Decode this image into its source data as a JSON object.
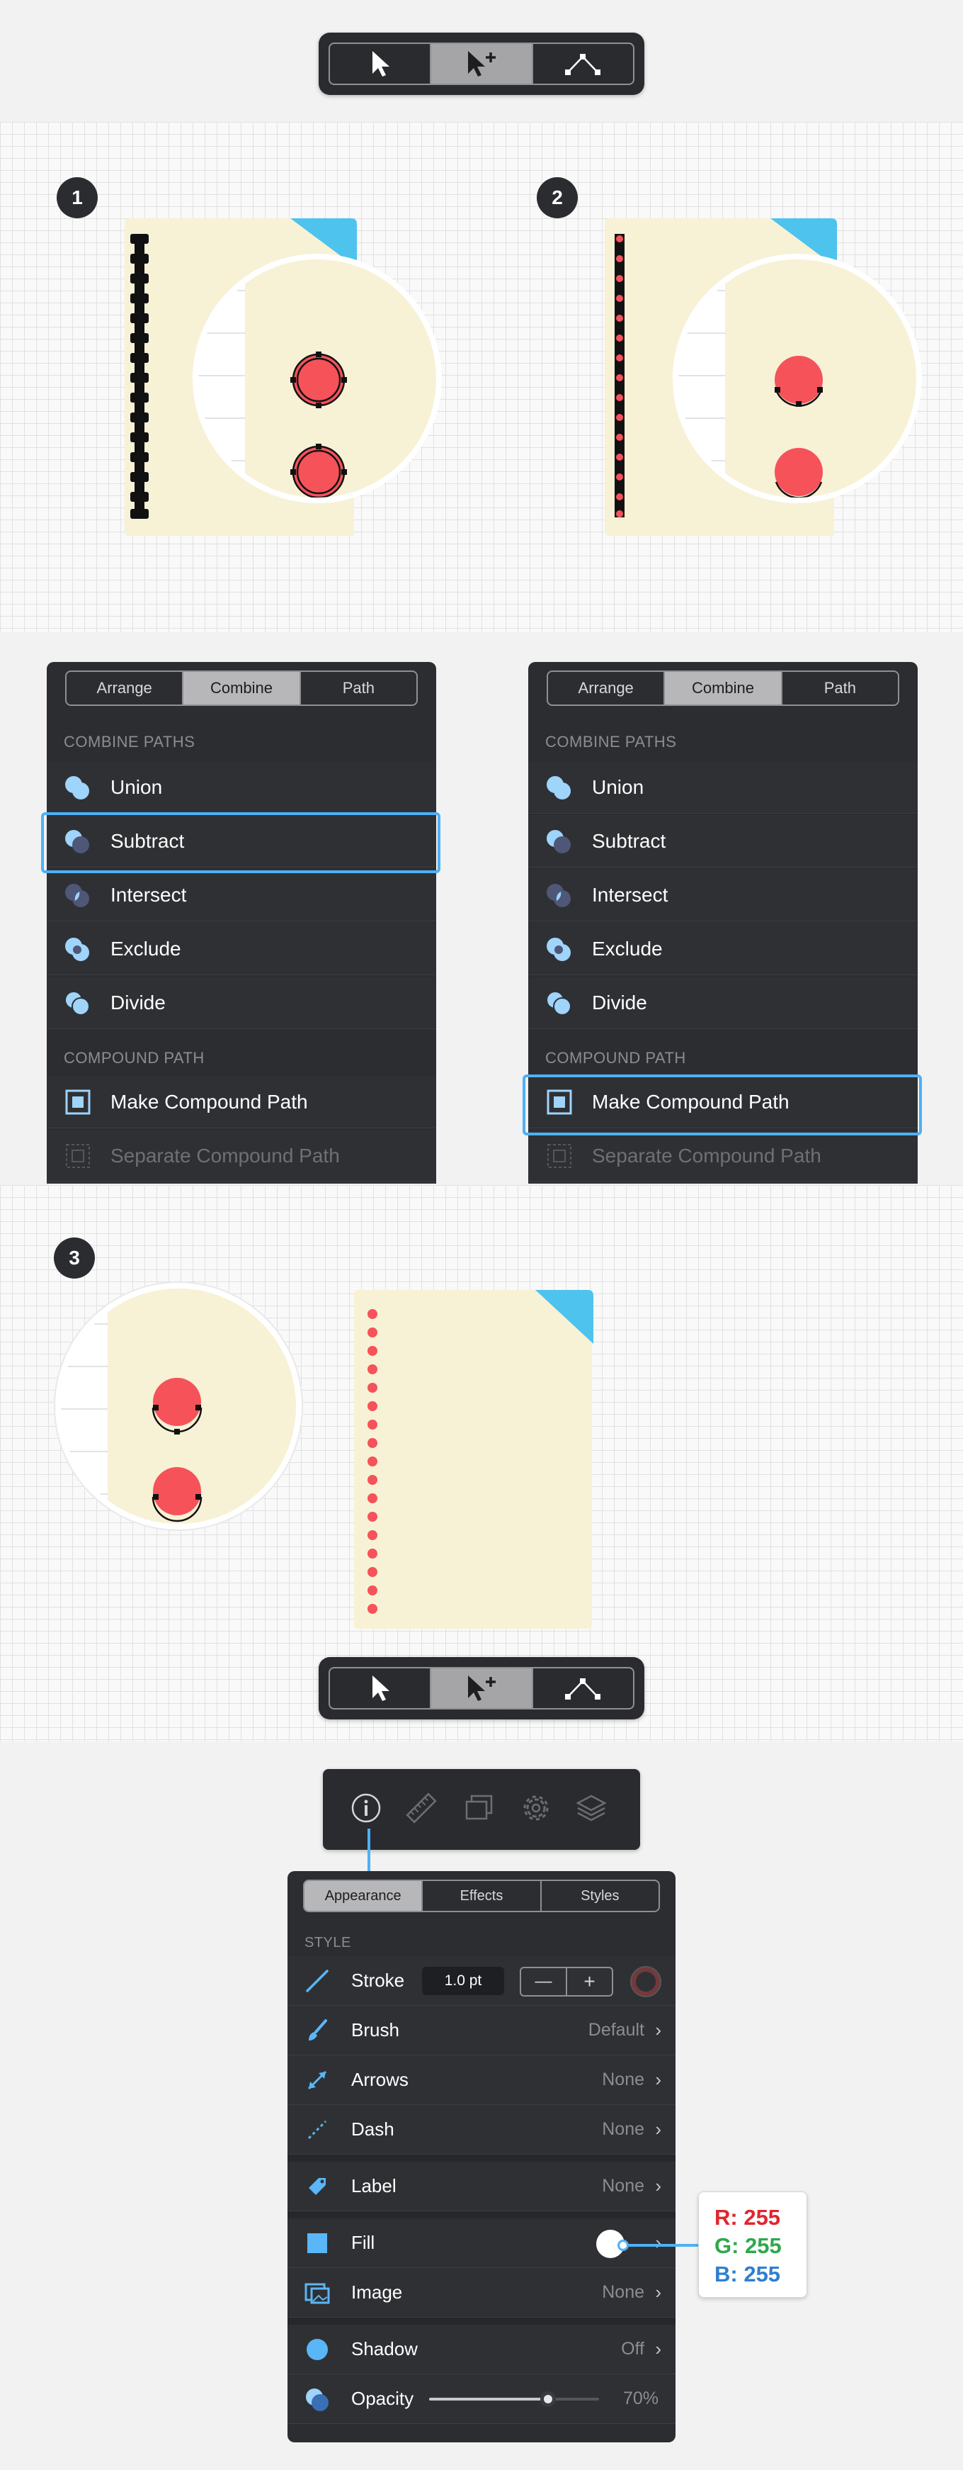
{
  "toolbar": {
    "tools": [
      {
        "name": "select-arrow-icon",
        "active": false
      },
      {
        "name": "direct-select-add-icon",
        "active": true
      },
      {
        "name": "node-path-icon",
        "active": false
      }
    ]
  },
  "steps": {
    "one": "1",
    "two": "2",
    "three": "3"
  },
  "combine_panel": {
    "tabs": [
      "Arrange",
      "Combine",
      "Path"
    ],
    "active_tab": "Combine",
    "section_combine": "COMBINE PATHS",
    "items": [
      "Union",
      "Subtract",
      "Intersect",
      "Exclude",
      "Divide"
    ],
    "section_compound": "COMPOUND PATH",
    "compound_items": [
      "Make Compound Path",
      "Separate Compound Path"
    ],
    "left_highlight": "Subtract",
    "right_highlight": "Make Compound Path"
  },
  "inspector": {
    "tabs": [
      "Appearance",
      "Effects",
      "Styles"
    ],
    "active_tab": "Appearance",
    "section_style": "STYLE",
    "stroke": {
      "label": "Stroke",
      "value": "1.0 pt",
      "minus": "—",
      "plus": "+"
    },
    "rows": [
      {
        "label": "Brush",
        "value": "Default"
      },
      {
        "label": "Arrows",
        "value": "None"
      },
      {
        "label": "Dash",
        "value": "None"
      },
      {
        "label": "Label",
        "value": "None"
      },
      {
        "label": "Fill",
        "value": ""
      },
      {
        "label": "Image",
        "value": "None"
      },
      {
        "label": "Shadow",
        "value": "Off"
      },
      {
        "label": "Opacity",
        "value": "70%"
      }
    ],
    "opacity_fraction": 0.7
  },
  "color_callout": {
    "r": "R: 255",
    "g": "G: 255",
    "b": "B: 255"
  },
  "colors": {
    "paper": "#f7f1d6",
    "corner": "#4dc3ee",
    "red": "#f5525a",
    "accent": "#4fb0f5",
    "panel": "#2c2d31"
  }
}
